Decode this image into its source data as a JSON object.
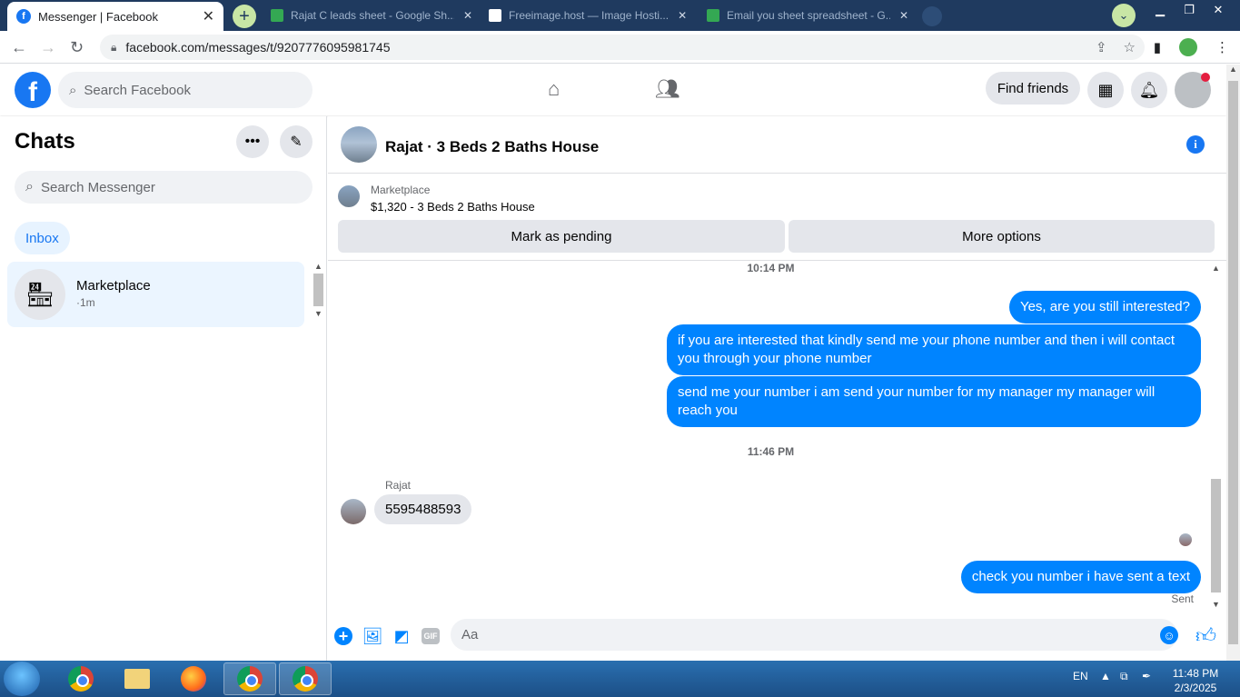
{
  "browser": {
    "active_tab_title": "Messenger | Facebook",
    "new_tab": "+",
    "background_tabs": [
      {
        "title": "Rajat C leads sheet - Google Sh...",
        "color": "#34a853"
      },
      {
        "title": "Freeimage.host — Image Hosti...",
        "color": "#ffffff"
      },
      {
        "title": "Email you sheet spreadsheet - G...",
        "color": "#34a853"
      }
    ],
    "url": "facebook.com/messages/t/9207776095981745"
  },
  "fb_header": {
    "logo": "f",
    "search_placeholder": "Search Facebook",
    "find_friends": "Find friends"
  },
  "left_panel": {
    "title": "Chats",
    "search_placeholder": "Search Messenger",
    "inbox_label": "Inbox",
    "conversation": {
      "name": "Marketplace",
      "time": "·1m"
    }
  },
  "conversation": {
    "title": "Rajat · 3 Beds 2 Baths House",
    "marketplace_label": "Marketplace",
    "listing": "$1,320 - 3 Beds 2 Baths House",
    "mark_pending": "Mark as pending",
    "more_options": "More options",
    "timestamp_1": "10:14 PM",
    "outgoing_1": "Yes, are you still interested?",
    "outgoing_2": "if you are interested that kindly send me your phone number and then i will contact you through your phone number",
    "outgoing_3": "send me your number i am send your number for my manager my manager will reach you",
    "timestamp_2": "11:46 PM",
    "sender": "Rajat",
    "incoming_1": "5595488593",
    "outgoing_4": "check you number i have sent a text",
    "status": "Sent",
    "composer_placeholder": "Aa",
    "gif": "GIF"
  },
  "taskbar": {
    "language": "EN",
    "time": "11:48 PM",
    "date": "2/3/2025"
  },
  "colors": {
    "brand": "#1877f2",
    "bubble_out": "#0084ff",
    "bubble_in": "#e4e6eb"
  }
}
